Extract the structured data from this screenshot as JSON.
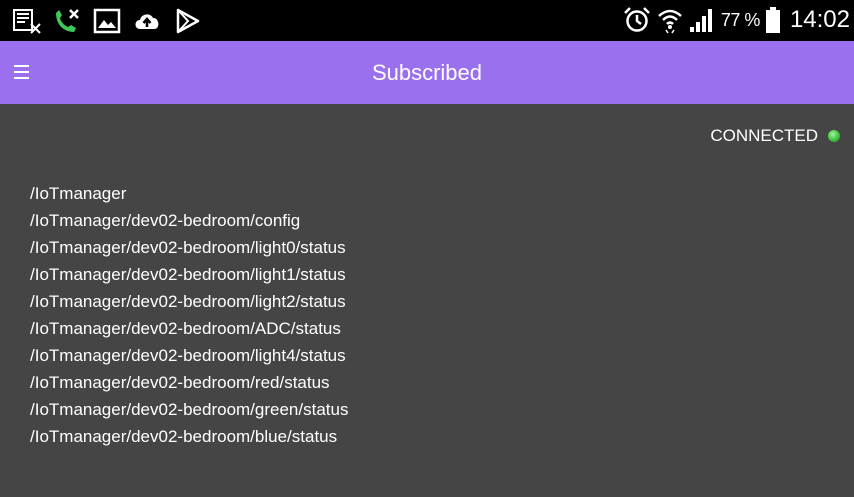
{
  "status_bar": {
    "left_icons": [
      "notification-off-icon",
      "missed-call-icon",
      "gallery-icon",
      "cloud-upload-icon",
      "play-store-icon"
    ],
    "right_icons": [
      "alarm-icon",
      "wifi-icon",
      "signal-icon",
      "battery-icon"
    ],
    "battery_percent": "77 %",
    "battery_level": 0.77,
    "time": "14:02"
  },
  "app_bar": {
    "menu_icon": "hamburger-menu-icon",
    "title": "Subscribed",
    "color": "#9a70ee"
  },
  "connection": {
    "label": "CONNECTED",
    "indicator_color": "#3fc13f"
  },
  "topics": [
    "/IoTmanager",
    "/IoTmanager/dev02-bedroom/config",
    "/IoTmanager/dev02-bedroom/light0/status",
    "/IoTmanager/dev02-bedroom/light1/status",
    "/IoTmanager/dev02-bedroom/light2/status",
    "/IoTmanager/dev02-bedroom/ADC/status",
    "/IoTmanager/dev02-bedroom/light4/status",
    "/IoTmanager/dev02-bedroom/red/status",
    "/IoTmanager/dev02-bedroom/green/status",
    "/IoTmanager/dev02-bedroom/blue/status"
  ],
  "colors": {
    "background": "#454545",
    "status_bar": "#000000",
    "text": "#ffffff"
  }
}
